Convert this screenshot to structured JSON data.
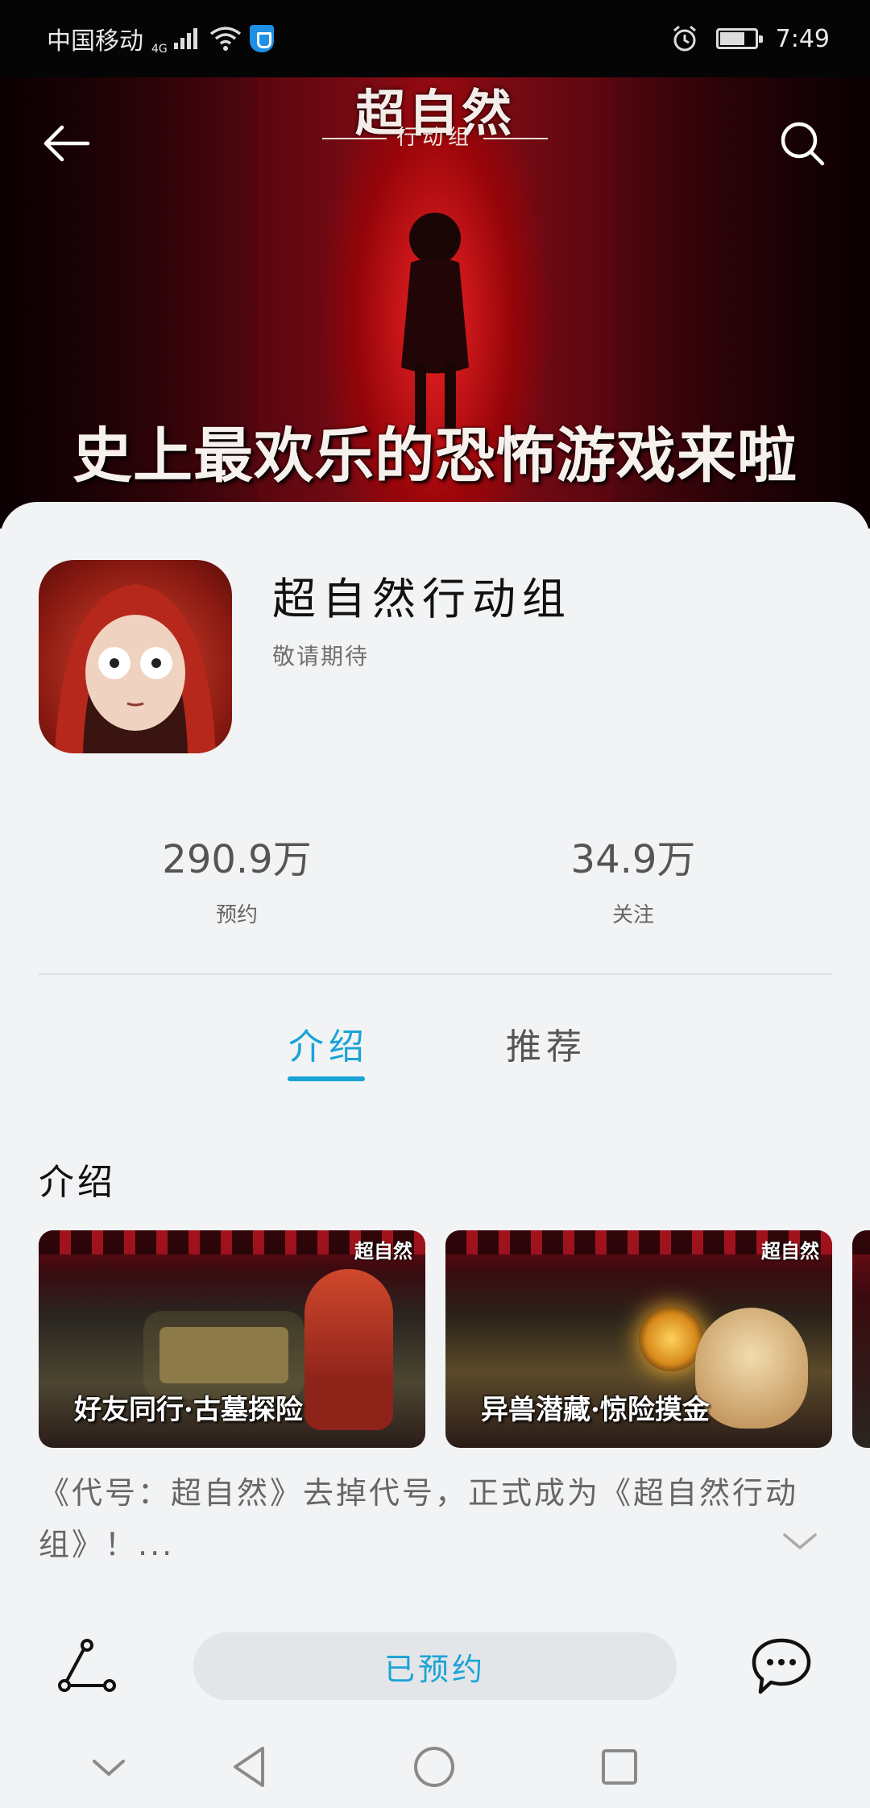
{
  "status_bar": {
    "carrier": "中国移动",
    "network": "4G",
    "time": "7:49"
  },
  "banner": {
    "logo_title": "超自然",
    "logo_subtitle": "行动组",
    "slogan": "史上最欢乐的恐怖游戏来啦"
  },
  "app": {
    "name": "超自然行动组",
    "status": "敬请期待",
    "stats": [
      {
        "value": "290.9万",
        "label": "预约"
      },
      {
        "value": "34.9万",
        "label": "关注"
      }
    ]
  },
  "tabs": [
    {
      "label": "介绍",
      "active": true
    },
    {
      "label": "推荐",
      "active": false
    }
  ],
  "intro": {
    "title": "介绍",
    "screenshots": [
      {
        "caption": "好友同行·古墓探险",
        "logo": "超自然"
      },
      {
        "caption": "异兽潜藏·惊险摸金",
        "logo": "超自然"
      }
    ],
    "description": "《代号：超自然》去掉代号，正式成为《超自然行动组》！..."
  },
  "actions": {
    "reserve_label": "已预约"
  },
  "icons": {
    "back": "back-arrow-icon",
    "search": "search-icon",
    "share": "share-icon",
    "comment": "comment-icon",
    "expand": "chevron-down-icon"
  },
  "colors": {
    "accent": "#1aa3d6",
    "background": "#f1f3f5"
  }
}
